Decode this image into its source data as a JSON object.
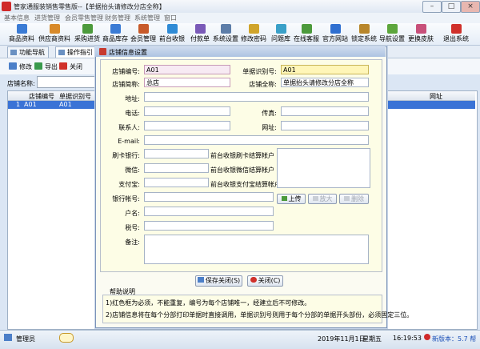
{
  "window": {
    "title": "管家通服装销售零售版--【单据抬头请修改分店全称】",
    "minimize": "–",
    "maximize": "□",
    "close": "×"
  },
  "menu": [
    "基本信息",
    "进货管理",
    "会员零售管理",
    "财务管理",
    "系统管理",
    "窗口"
  ],
  "toolbar": [
    {
      "label": "商品资料",
      "icon": "goods-icon",
      "color": "#3a7bd5"
    },
    {
      "label": "供应商资料",
      "icon": "supplier-icon",
      "color": "#d88a2a"
    },
    {
      "label": "采购进货",
      "icon": "purchase-icon",
      "color": "#4c9a3c"
    },
    {
      "label": "商品库存",
      "icon": "inventory-icon",
      "color": "#3a7bd5"
    },
    {
      "label": "会员管理",
      "icon": "member-icon",
      "color": "#c85a2a"
    },
    {
      "label": "前台收银",
      "icon": "cashier-icon",
      "color": "#2f8bd6"
    },
    {
      "label": "付款单",
      "icon": "payment-icon",
      "color": "#7a5ab8"
    },
    {
      "label": "系统设置",
      "icon": "settings-icon",
      "color": "#5d7da8"
    },
    {
      "label": "修改密码",
      "icon": "password-icon",
      "color": "#d0a42a"
    },
    {
      "label": "问题库",
      "icon": "faq-icon",
      "color": "#3aa0c8"
    },
    {
      "label": "在线客服",
      "icon": "support-icon",
      "color": "#4c9a3c"
    },
    {
      "label": "官方网站",
      "icon": "website-icon",
      "color": "#2f6fd0"
    },
    {
      "label": "锁定系统",
      "icon": "lock-icon",
      "color": "#b8862a"
    },
    {
      "label": "导航设置",
      "icon": "navigation-icon",
      "color": "#5da63c"
    },
    {
      "label": "更换皮肤",
      "icon": "skin-icon",
      "color": "#c8507a"
    },
    {
      "label": "退出系统",
      "icon": "exit-icon",
      "color": "#d0302a"
    }
  ],
  "tabs": [
    "功能导航",
    "操作指引"
  ],
  "subtoolbar": [
    {
      "label": "修改",
      "icon": "edit-icon",
      "color": "#4c7fc8"
    },
    {
      "label": "导出",
      "icon": "export-icon",
      "color": "#3a9a4c"
    },
    {
      "label": "关闭",
      "icon": "close-icon",
      "color": "#d0302a"
    }
  ],
  "filter": {
    "label": "店铺名称:",
    "value": ""
  },
  "grid": {
    "headers": [
      "店铺编号",
      "单据识别号",
      "网址"
    ],
    "row": {
      "num": "1",
      "shop_no": "A01",
      "doc_id": "A01"
    }
  },
  "status": {
    "user": "管理员",
    "date": "2019年11月1日",
    "weekday": "星期五",
    "time": "16:19:53",
    "new_version": "新版本：5.7 帮"
  },
  "dialog": {
    "title": "店铺信息设置",
    "fields": {
      "shop_no": {
        "label": "店铺编号:",
        "value": "A01"
      },
      "doc_id": {
        "label": "单据识别号:",
        "value": "A01"
      },
      "short_name": {
        "label": "店铺简称:",
        "value": "总店"
      },
      "full_name": {
        "label": "店铺全称:",
        "value": "单据抬头请修改分店全称"
      },
      "address": {
        "label": "地址:",
        "value": ""
      },
      "phone": {
        "label": "电话:",
        "value": ""
      },
      "fax": {
        "label": "传真:",
        "value": ""
      },
      "contact": {
        "label": "联系人:",
        "value": ""
      },
      "website": {
        "label": "网址:",
        "value": ""
      },
      "email": {
        "label": "E-mail:",
        "value": ""
      },
      "card_bank": {
        "label": "刷卡银行:",
        "value": ""
      },
      "card_note": "前台收银刷卡结算帐户",
      "wechat": {
        "label": "微信:",
        "value": ""
      },
      "wechat_note": "前台收银微信结算帐户",
      "alipay": {
        "label": "支付宝:",
        "value": ""
      },
      "alipay_note": "前台收银支付宝结算帐户",
      "bank_account": {
        "label": "银行帐号:",
        "value": ""
      },
      "account_name": {
        "label": "户名:",
        "value": ""
      },
      "tax_no": {
        "label": "税号:",
        "value": ""
      },
      "remark": {
        "label": "备注:",
        "value": ""
      }
    },
    "image_buttons": {
      "upload": "上传",
      "zoom": "放大",
      "delete": "删除"
    },
    "save": "保存关闭(S)",
    "close": "关闭(C)",
    "help": {
      "title": "帮助说明",
      "line1": "1)红色框为必须，不能重复，编号为每个店铺唯一，经建立后不可修改。",
      "line2": "2)店铺信息将在每个分部打印单据时直接调用，单据识别号则用于每个分部的单据开头部份，必须固定三位。"
    }
  }
}
